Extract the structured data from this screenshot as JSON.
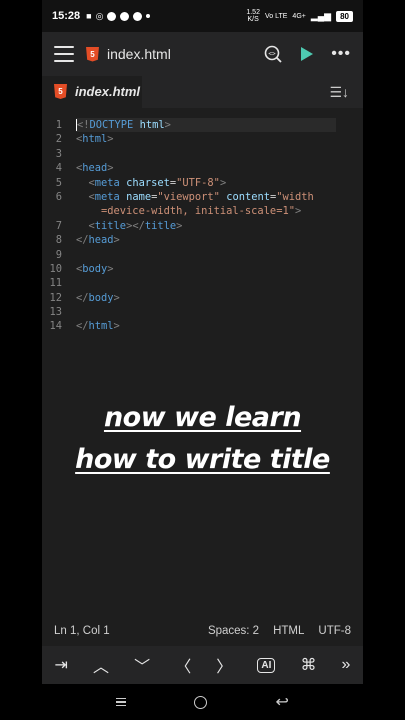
{
  "status_bar": {
    "time": "15:28",
    "net_speed": "1.52",
    "net_unit": "K/S",
    "vo_lte": "Vo LTE",
    "signal": "4G+",
    "battery": "80"
  },
  "toolbar": {
    "file_icon": "html5-icon",
    "title": "index.html"
  },
  "tab": {
    "label": "index.html"
  },
  "editor": {
    "line_numbers": [
      "1",
      "2",
      "3",
      "4",
      "5",
      "6",
      "",
      "7",
      "8",
      "9",
      "10",
      "11",
      "12",
      "13",
      "14"
    ]
  },
  "caption": {
    "line1": "now we learn",
    "line2": "how to write title"
  },
  "status_line": {
    "position": "Ln 1, Col 1",
    "spaces": "Spaces: 2",
    "language": "HTML",
    "encoding": "UTF-8"
  },
  "colors": {
    "tag": "#569cd6",
    "attribute": "#9cdcfe",
    "string": "#ce9178",
    "run": "#4ec9b0",
    "html5": "#e44d26"
  }
}
